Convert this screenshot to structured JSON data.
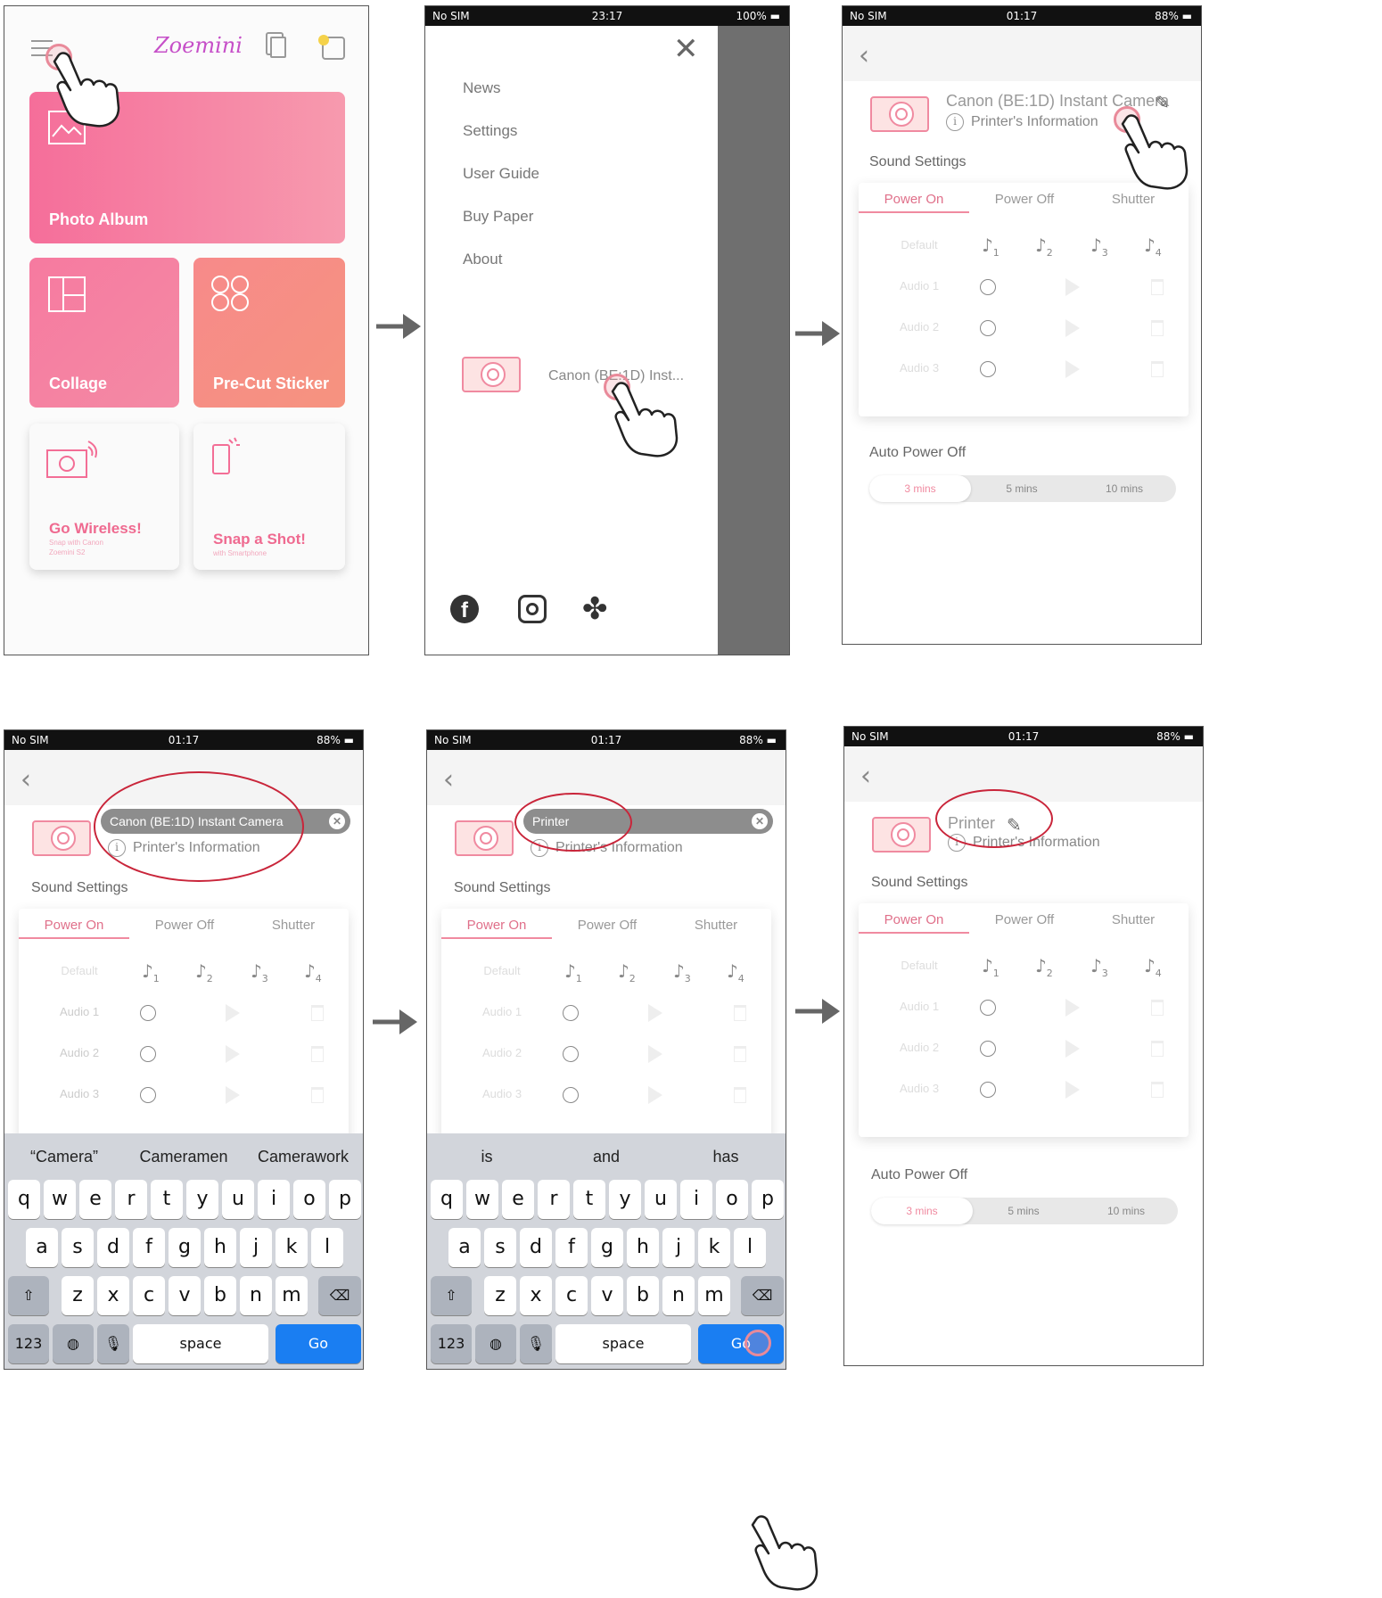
{
  "p1": {
    "app_title": "Zoemini",
    "tiles": {
      "photo_album": "Photo Album",
      "collage": "Collage",
      "precut": "Pre-Cut Sticker",
      "wireless_title": "Go Wireless!",
      "wireless_sub": "Snap with Canon Zoemini S2",
      "snap_title": "Snap a Shot!",
      "snap_sub": "with Smartphone"
    }
  },
  "p2": {
    "status": {
      "carrier": "No SIM",
      "time": "23:17",
      "battery": "100%"
    },
    "menu": [
      "News",
      "Settings",
      "User Guide",
      "Buy Paper",
      "About"
    ],
    "device": "Canon (BE:1D) Inst..."
  },
  "p3": {
    "status": {
      "carrier": "No SIM",
      "time": "01:17",
      "battery": "88%"
    },
    "printer_name": "Canon (BE:1D) Instant Camera",
    "printer_info": "Printer's Information",
    "sound_settings": "Sound Settings",
    "tabs": [
      "Power On",
      "Power Off",
      "Shutter"
    ],
    "rows": [
      "Default",
      "Audio 1",
      "Audio 2",
      "Audio 3"
    ],
    "auto_power_off": "Auto Power Off",
    "apo_options": [
      "3 mins",
      "5 mins",
      "10 mins"
    ]
  },
  "p4": {
    "status": {
      "carrier": "No SIM",
      "time": "01:17",
      "battery": "88%"
    },
    "edit_value": "Canon (BE:1D) Instant Camera",
    "suggestions": [
      "“Camera”",
      "Cameramen",
      "Camerawork"
    ]
  },
  "p5": {
    "status": {
      "carrier": "No SIM",
      "time": "01:17",
      "battery": "88%"
    },
    "edit_value": "Printer",
    "suggestions": [
      "is",
      "and",
      "has"
    ]
  },
  "p6": {
    "status": {
      "carrier": "No SIM",
      "time": "01:17",
      "battery": "88%"
    },
    "printer_name": "Printer"
  },
  "keyboard": {
    "row1": [
      "q",
      "w",
      "e",
      "r",
      "t",
      "y",
      "u",
      "i",
      "o",
      "p"
    ],
    "row2": [
      "a",
      "s",
      "d",
      "f",
      "g",
      "h",
      "j",
      "k",
      "l"
    ],
    "row3": [
      "z",
      "x",
      "c",
      "v",
      "b",
      "n",
      "m"
    ],
    "num": "123",
    "space": "space",
    "go": "Go"
  },
  "colors": {
    "accent": "#f08aa0",
    "brand_pink": "#f36e96",
    "go_blue": "#1a7ef2",
    "annotation_red": "#c9253a"
  }
}
